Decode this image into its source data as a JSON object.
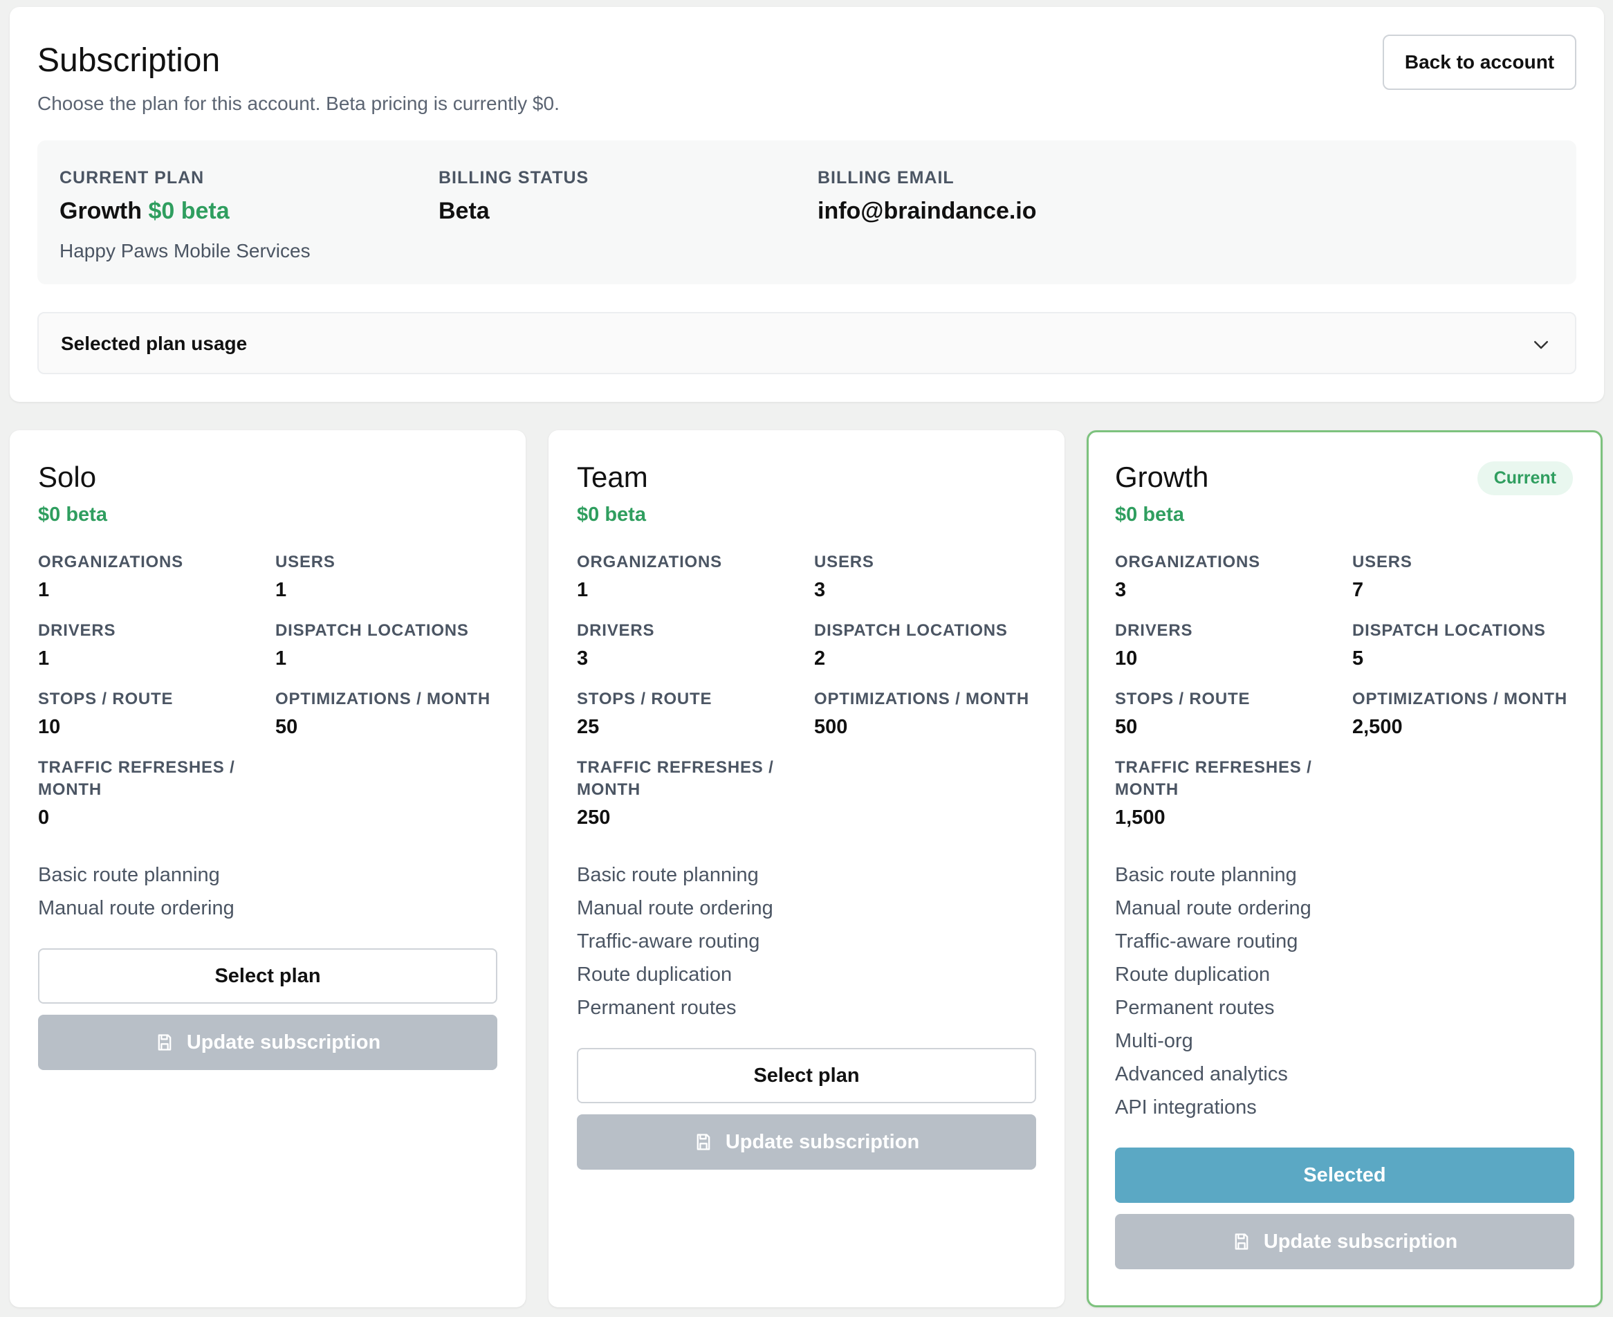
{
  "header": {
    "title": "Subscription",
    "subtitle": "Choose the plan for this account. Beta pricing is currently $0.",
    "back_label": "Back to account"
  },
  "summary": {
    "current_plan_label": "CURRENT PLAN",
    "current_plan_name": "Growth",
    "current_plan_price": "$0 beta",
    "organization": "Happy Paws Mobile Services",
    "billing_status_label": "BILLING STATUS",
    "billing_status": "Beta",
    "billing_email_label": "BILLING EMAIL",
    "billing_email": "info@braindance.io"
  },
  "usage": {
    "label": "Selected plan usage"
  },
  "labels": {
    "organizations": "ORGANIZATIONS",
    "users": "USERS",
    "drivers": "DRIVERS",
    "dispatch_locations": "DISPATCH LOCATIONS",
    "stops_route": "STOPS / ROUTE",
    "optimizations_month": "OPTIMIZATIONS / MONTH",
    "traffic_refreshes": "TRAFFIC REFRESHES / MONTH",
    "select_plan": "Select plan",
    "selected": "Selected",
    "update_subscription": "Update subscription",
    "current_badge": "Current"
  },
  "plans": [
    {
      "name": "Solo",
      "price": "$0 beta",
      "organizations": "1",
      "users": "1",
      "drivers": "1",
      "dispatch_locations": "1",
      "stops_route": "10",
      "optimizations_month": "50",
      "traffic_refreshes": "0",
      "features": [
        "Basic route planning",
        "Manual route ordering"
      ]
    },
    {
      "name": "Team",
      "price": "$0 beta",
      "organizations": "1",
      "users": "3",
      "drivers": "3",
      "dispatch_locations": "2",
      "stops_route": "25",
      "optimizations_month": "500",
      "traffic_refreshes": "250",
      "features": [
        "Basic route planning",
        "Manual route ordering",
        "Traffic-aware routing",
        "Route duplication",
        "Permanent routes"
      ]
    },
    {
      "name": "Growth",
      "price": "$0 beta",
      "organizations": "3",
      "users": "7",
      "drivers": "10",
      "dispatch_locations": "5",
      "stops_route": "50",
      "optimizations_month": "2,500",
      "traffic_refreshes": "1,500",
      "features": [
        "Basic route planning",
        "Manual route ordering",
        "Traffic-aware routing",
        "Route duplication",
        "Permanent routes",
        "Multi-org",
        "Advanced analytics",
        "API integrations"
      ]
    }
  ],
  "colors": {
    "accent_green": "#2f9e5f",
    "selected_blue": "#5ba8c4",
    "disabled_gray": "#b8bfc7",
    "current_border": "#7dc27e"
  },
  "icons": {
    "chevron": "chevron-down-icon",
    "save": "save-icon"
  }
}
